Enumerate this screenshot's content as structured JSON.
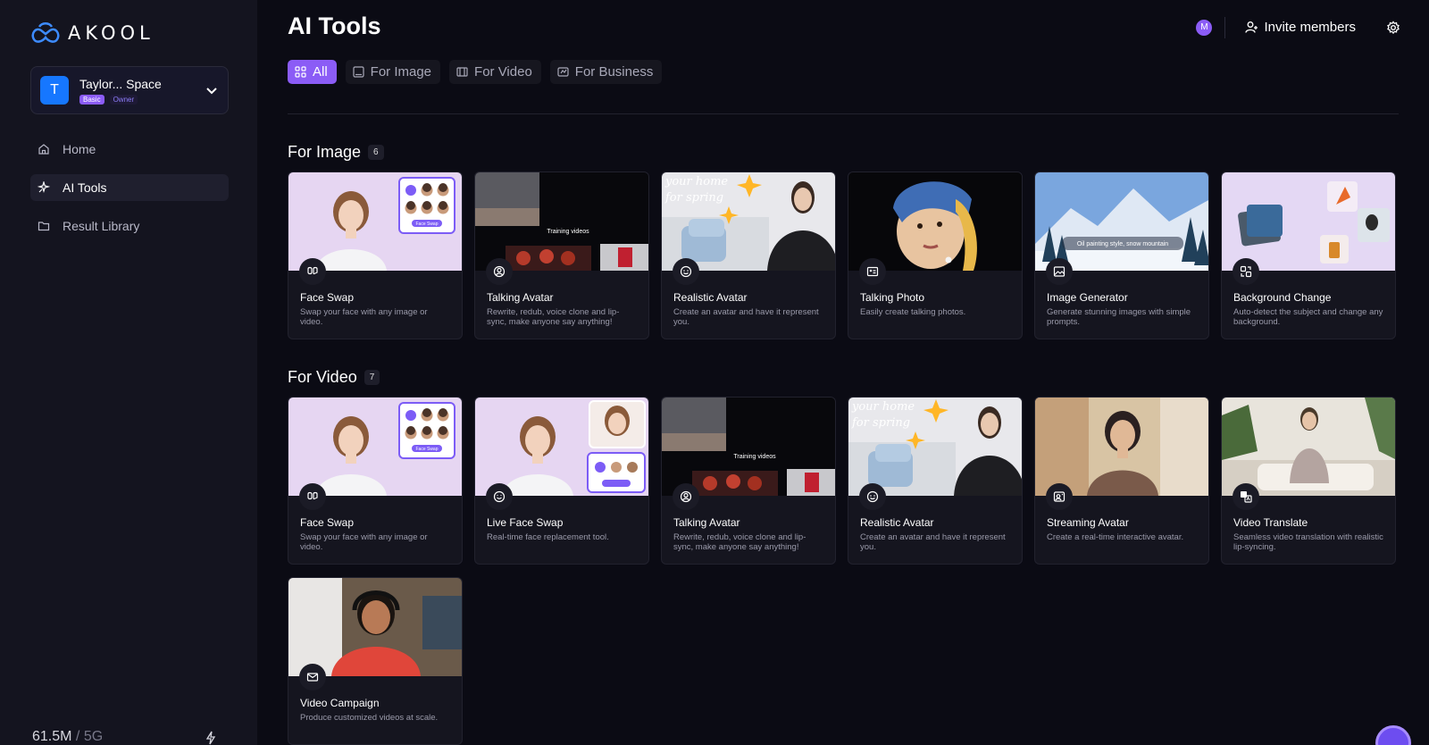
{
  "brand": {
    "logo_text": "AKOOL"
  },
  "workspace": {
    "avatar_letter": "T",
    "name": "Taylor... Space",
    "plan_badge": "Basic",
    "role_badge": "Owner"
  },
  "nav": [
    {
      "label": "Home",
      "icon": "home-icon"
    },
    {
      "label": "AI Tools",
      "icon": "ai-tools-icon",
      "active": true
    },
    {
      "label": "Result Library",
      "icon": "folder-icon"
    }
  ],
  "storage": {
    "used": "61.5M",
    "total": "5G"
  },
  "header": {
    "title": "AI Tools",
    "user_initial": "M",
    "invite_label": "Invite members"
  },
  "tabs": [
    {
      "label": "All",
      "icon": "grid-icon",
      "active": true
    },
    {
      "label": "For Image",
      "icon": "image-icon"
    },
    {
      "label": "For Video",
      "icon": "film-icon"
    },
    {
      "label": "For Business",
      "icon": "business-icon"
    }
  ],
  "sections": [
    {
      "title": "For Image",
      "count": "6",
      "cards": [
        {
          "title": "Face Swap",
          "desc": "Swap your face with any image or video.",
          "icon": "face-swap-icon",
          "thumb": "faceswap"
        },
        {
          "title": "Talking Avatar",
          "desc": "Rewrite, redub, voice clone and lip-sync, make anyone say anything!",
          "icon": "avatar-icon",
          "thumb": "talking"
        },
        {
          "title": "Realistic Avatar",
          "desc": "Create an avatar and have it represent you.",
          "icon": "smile-icon",
          "thumb": "realistic"
        },
        {
          "title": "Talking Photo",
          "desc": "Easily create talking photos.",
          "icon": "photo-icon",
          "thumb": "pearl"
        },
        {
          "title": "Image Generator",
          "desc": "Generate stunning images with simple prompts.",
          "icon": "image-gen-icon",
          "thumb": "mountain"
        },
        {
          "title": "Background Change",
          "desc": "Auto-detect the subject and change any background.",
          "icon": "background-icon",
          "thumb": "bgchange"
        }
      ]
    },
    {
      "title": "For Video",
      "count": "7",
      "cards": [
        {
          "title": "Face Swap",
          "desc": "Swap your face with any image or video.",
          "icon": "face-swap-icon",
          "thumb": "faceswap"
        },
        {
          "title": "Live Face Swap",
          "desc": "Real-time face replacement tool.",
          "icon": "live-smile-icon",
          "thumb": "liveswap"
        },
        {
          "title": "Talking Avatar",
          "desc": "Rewrite, redub, voice clone and lip-sync, make anyone say anything!",
          "icon": "avatar-icon",
          "thumb": "talking"
        },
        {
          "title": "Realistic Avatar",
          "desc": "Create an avatar and have it represent you.",
          "icon": "smile-icon",
          "thumb": "realistic"
        },
        {
          "title": "Streaming Avatar",
          "desc": "Create a real-time interactive avatar.",
          "icon": "streaming-icon",
          "thumb": "streaming"
        },
        {
          "title": "Video Translate",
          "desc": "Seamless video translation with realistic lip-syncing.",
          "icon": "translate-icon",
          "thumb": "translate"
        },
        {
          "title": "Video Campaign",
          "desc": "Produce customized videos at scale.",
          "icon": "mail-icon",
          "thumb": "campaign"
        }
      ]
    }
  ],
  "thumb_text": {
    "training": "Training videos",
    "spring": "your home\nfor spring",
    "oil": "Oil painting style, snow mountain",
    "faceswap_btn": "Face Swap"
  },
  "colors": {
    "accent": "#8b5cf6",
    "brand_blue": "#1677ff",
    "bg": "#0b0b14",
    "sidebar": "#14141f"
  }
}
